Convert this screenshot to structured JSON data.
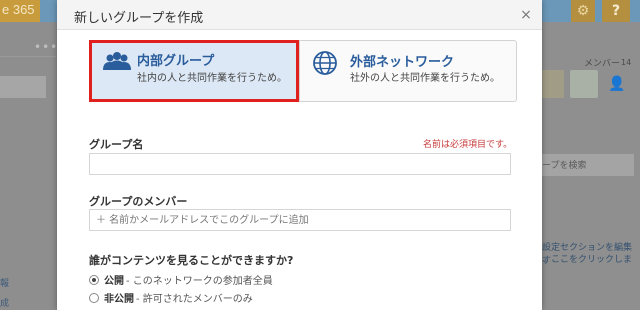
{
  "background": {
    "brand_text": "e 365",
    "gear_icon": "gear-icon",
    "help_label": "?",
    "dots": "•••",
    "members_label": "メンバー",
    "members_count": "14",
    "people_search_placeholder": "ープを検索",
    "edit_line1": "設定セクションを編集す",
    "edit_line2": "、ここをクリックしま",
    "left_link1": "報",
    "left_link2": "成"
  },
  "dialog": {
    "title": "新しいグループを作成",
    "close_label": "×",
    "type_cards": [
      {
        "title": "内部グループ",
        "description": "社内の人と共同作業を行うため。",
        "icon": "people-icon",
        "selected": true
      },
      {
        "title": "外部ネットワーク",
        "description": "社外の人と共同作業を行うため。",
        "icon": "globe-icon",
        "selected": false
      }
    ],
    "group_name": {
      "label": "グループ名",
      "required_note": "名前は必須項目です。",
      "value": ""
    },
    "group_members": {
      "label": "グループのメンバー",
      "placeholder": "＋ 名前かメールアドレスでこのグループに追加"
    },
    "visibility": {
      "label": "誰がコンテンツを見ることができますか?",
      "options": [
        {
          "strong": "公開",
          "rest": " - このネットワークの参加者全員",
          "checked": true
        },
        {
          "strong": "非公開",
          "rest": " - 許可されたメンバーのみ",
          "checked": false
        }
      ]
    }
  },
  "colors": {
    "accent": "#2a5d9c",
    "selection_border": "#e01f1f",
    "required": "#c73a3a"
  }
}
